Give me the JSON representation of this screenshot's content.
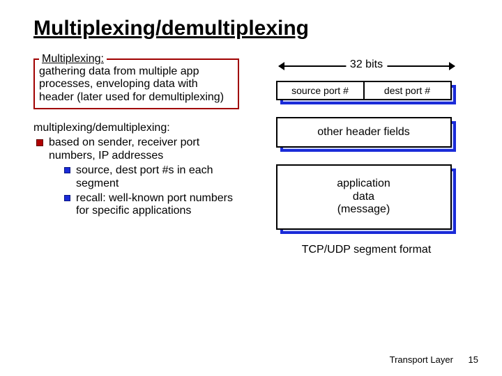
{
  "title": "Multiplexing/demultiplexing",
  "box": {
    "legend": "Multiplexing:",
    "body": "gathering data from multiple app processes, enveloping data with header (later used for demultiplexing)"
  },
  "body": {
    "heading": "multiplexing/demultiplexing:",
    "bullets": [
      {
        "text": "based on sender, receiver port numbers, IP addresses",
        "sub": [
          "source, dest port #s in each segment",
          "recall: well-known port numbers for specific applications"
        ]
      }
    ]
  },
  "diagram": {
    "bits_label": "32 bits",
    "source_port": "source port #",
    "dest_port": "dest port #",
    "other_fields": "other header fields",
    "app_data": "application\ndata\n(message)",
    "caption": "TCP/UDP segment format"
  },
  "footer": {
    "section": "Transport Layer",
    "page": "15"
  }
}
